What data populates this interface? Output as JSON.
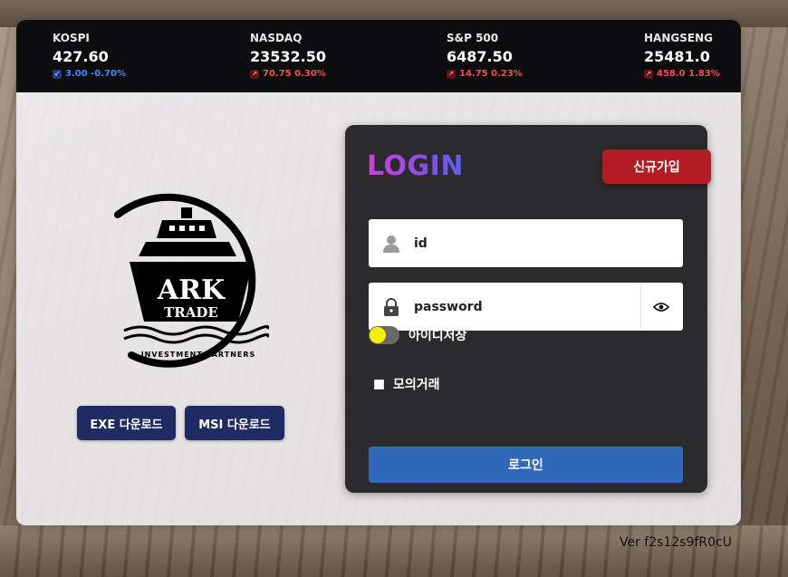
{
  "tickers": [
    {
      "name": "KOSPI",
      "price": "427.60",
      "change": "3.00 -0.70%",
      "direction": "down"
    },
    {
      "name": "NASDAQ",
      "price": "23532.50",
      "change": "70.75 0.30%",
      "direction": "up"
    },
    {
      "name": "S&P 500",
      "price": "6487.50",
      "change": "14.75 0.23%",
      "direction": "up"
    },
    {
      "name": "HANGSENG",
      "price": "25481.0",
      "change": "458.0 1.83%",
      "direction": "up"
    }
  ],
  "logo": {
    "line1": "ARK",
    "line2": "TRADE",
    "tagline": "INVESTMENT PARTNERS"
  },
  "downloads": {
    "exe_label": "EXE 다운로드",
    "msi_label": "MSI 다운로드"
  },
  "login": {
    "title": "LOGIN",
    "signup_label": "신규가입",
    "id_value": "id",
    "password_value": "password",
    "save_id_label": "아이디저장",
    "save_id_on": true,
    "mock_trade_label": "모의거래",
    "mock_trade_checked": false,
    "submit_label": "로그인"
  },
  "version": "Ver f2s12s9fR0cU",
  "colors": {
    "ticker_bg": "#0d0d0f",
    "down": "#3d8bff",
    "up": "#ff4a4a",
    "panel_bg": "#2b2b2d",
    "signup": "#b31c22",
    "login_button": "#2f69b8",
    "download_button": "#1f2c63",
    "toggle_knob": "#f2f200"
  }
}
